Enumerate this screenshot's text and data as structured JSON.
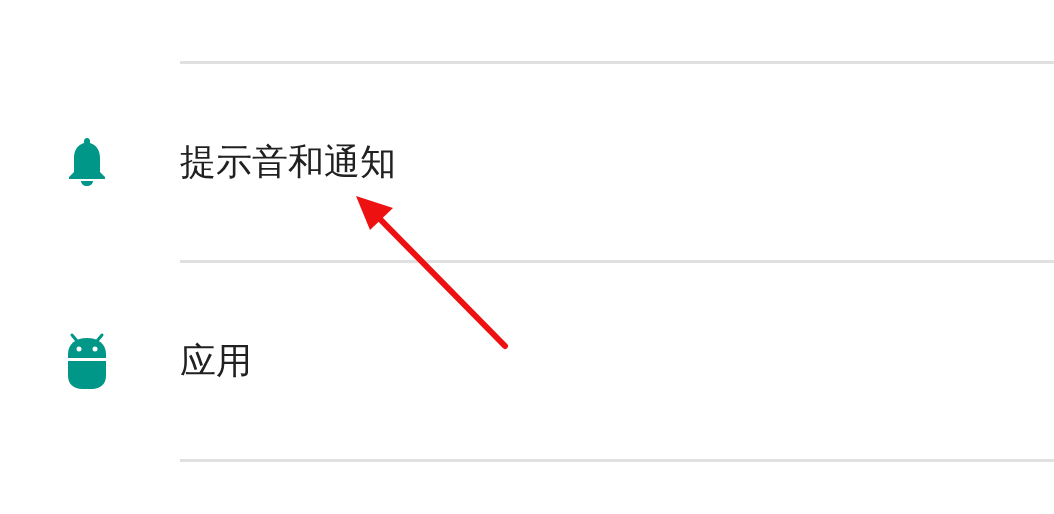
{
  "settings_items": [
    {
      "kind": "bell",
      "label": "提示音和通知"
    },
    {
      "kind": "android",
      "label": "应用"
    }
  ],
  "annotation": {
    "kind": "arrow"
  }
}
